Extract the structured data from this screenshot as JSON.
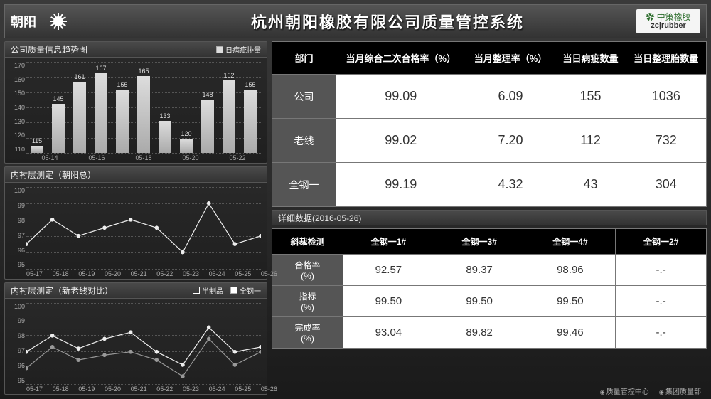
{
  "header": {
    "brand_left": "朝阳",
    "title": "杭州朝阳橡胶有限公司质量管控系统",
    "brand_right_top": "✿ 中策橡胶",
    "brand_right_txt": "zc|rubber"
  },
  "panels": {
    "trend": {
      "title": "公司质量信息趋势图",
      "legend": "日病疵排量"
    },
    "inner_total": {
      "title": "内衬层测定（朝阳总）"
    },
    "inner_compare": {
      "title": "内衬层测定（新老线对比）",
      "legend_a": "半制品",
      "legend_b": "全钢一"
    }
  },
  "top_table": {
    "headers": [
      "部门",
      "当月综合二次合格率（%）",
      "当月整理率（%）",
      "当日病疵数量",
      "当日整理胎数量"
    ],
    "rows": [
      {
        "dept": "公司",
        "v": [
          "99.09",
          "6.09",
          "155",
          "1036"
        ]
      },
      {
        "dept": "老线",
        "v": [
          "99.02",
          "7.20",
          "112",
          "732"
        ]
      },
      {
        "dept": "全钢一",
        "v": [
          "99.19",
          "4.32",
          "43",
          "304"
        ]
      }
    ]
  },
  "detail": {
    "title": "详细数据(2016-05-26)",
    "col_head": "斜裁检测",
    "cols": [
      "全钢一1#",
      "全钢一3#",
      "全钢一4#",
      "全钢一2#"
    ],
    "rows": [
      {
        "metric": "合格率\n(%)",
        "v": [
          "92.57",
          "89.37",
          "98.96",
          "-.-"
        ]
      },
      {
        "metric": "指标\n(%)",
        "v": [
          "99.50",
          "99.50",
          "99.50",
          "-.-"
        ]
      },
      {
        "metric": "完成率\n(%)",
        "v": [
          "93.04",
          "89.82",
          "99.46",
          "-.-"
        ]
      }
    ]
  },
  "footer": {
    "a": "质量管控中心",
    "b": "集团质量部"
  },
  "chart_data": [
    {
      "id": "trend",
      "type": "bar",
      "title": "公司质量信息趋势图",
      "ylabel": "日病疵排量",
      "ylim": [
        110,
        175
      ],
      "yticks": [
        110,
        120,
        130,
        140,
        150,
        160,
        170
      ],
      "categories": [
        "05-14",
        "05-16",
        "05-18",
        "05-20",
        "05-22"
      ],
      "x_per_tick": 2,
      "values": [
        115,
        145,
        161,
        167,
        155,
        165,
        133,
        120,
        148,
        162,
        155
      ]
    },
    {
      "id": "inner_total",
      "type": "line",
      "title": "内衬层测定（朝阳总）",
      "ylim": [
        95,
        100
      ],
      "yticks": [
        95,
        96,
        97,
        98,
        99,
        100
      ],
      "categories": [
        "05-17",
        "05-18",
        "05-19",
        "05-20",
        "05-21",
        "05-22",
        "05-23",
        "05-24",
        "05-25",
        "05-26"
      ],
      "series": [
        {
          "name": "朝阳总",
          "values": [
            96.5,
            98.0,
            97.0,
            97.5,
            98.0,
            97.5,
            96.0,
            99.0,
            96.5,
            97.0
          ]
        }
      ]
    },
    {
      "id": "inner_compare",
      "type": "line",
      "title": "内衬层测定（新老线对比）",
      "ylim": [
        95,
        100
      ],
      "yticks": [
        95,
        96,
        97,
        98,
        99,
        100
      ],
      "categories": [
        "05-17",
        "05-18",
        "05-19",
        "05-20",
        "05-21",
        "05-22",
        "05-23",
        "05-24",
        "05-25",
        "05-26"
      ],
      "series": [
        {
          "name": "半制品",
          "values": [
            97.0,
            98.0,
            97.2,
            97.8,
            98.2,
            97.0,
            96.2,
            98.5,
            97.0,
            97.3
          ]
        },
        {
          "name": "全钢一",
          "values": [
            96.0,
            97.3,
            96.5,
            96.8,
            97.0,
            96.5,
            95.5,
            97.8,
            96.2,
            97.0
          ]
        }
      ]
    }
  ]
}
